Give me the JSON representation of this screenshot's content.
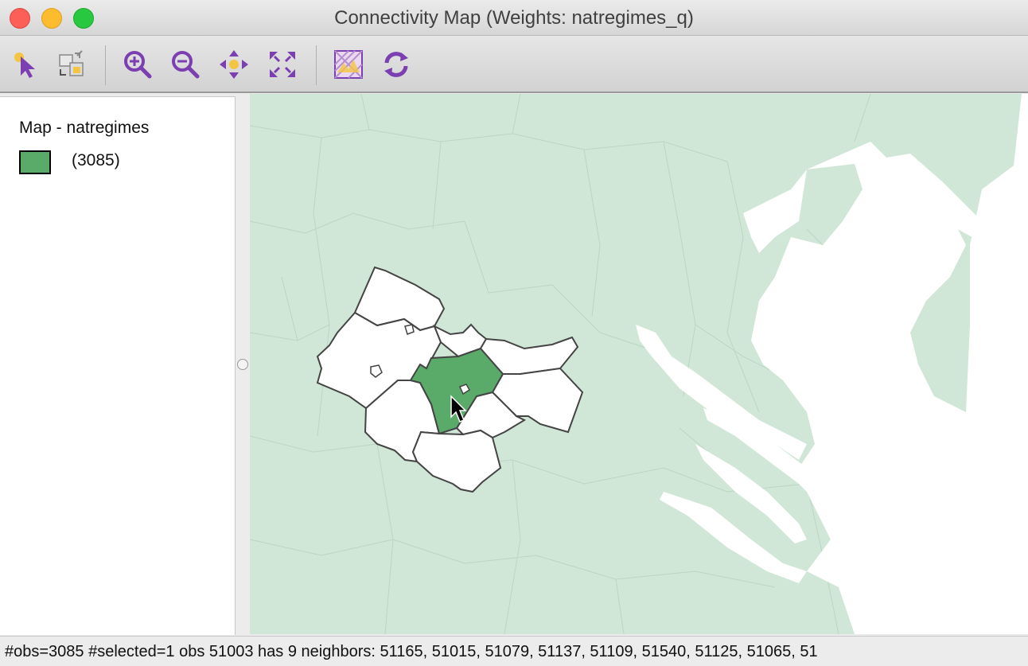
{
  "window": {
    "title": "Connectivity Map (Weights: natregimes_q)"
  },
  "toolbar": {
    "tools": [
      {
        "name": "select-tool-icon"
      },
      {
        "name": "selection-mode-icon"
      },
      {
        "name": "zoom-in-icon"
      },
      {
        "name": "zoom-out-icon"
      },
      {
        "name": "pan-icon"
      },
      {
        "name": "fit-to-window-icon"
      },
      {
        "name": "basemap-icon"
      },
      {
        "name": "refresh-icon"
      }
    ],
    "icon_color": "#7b3fb1",
    "accent_color": "#f4c542"
  },
  "legend": {
    "title": "Map - natregimes",
    "category_label": "(3085)",
    "swatch_color": "#5aaa6a"
  },
  "map": {
    "land_color": "#d0e6d6",
    "water_color": "#ffffff",
    "selected_color": "#5aaa6a",
    "neighbor_color": "#ffffff"
  },
  "status": {
    "text": "#obs=3085 #selected=1  obs 51003 has 9 neighbors: 51165, 51015, 51079, 51137, 51109, 51540, 51125, 51065, 51"
  }
}
